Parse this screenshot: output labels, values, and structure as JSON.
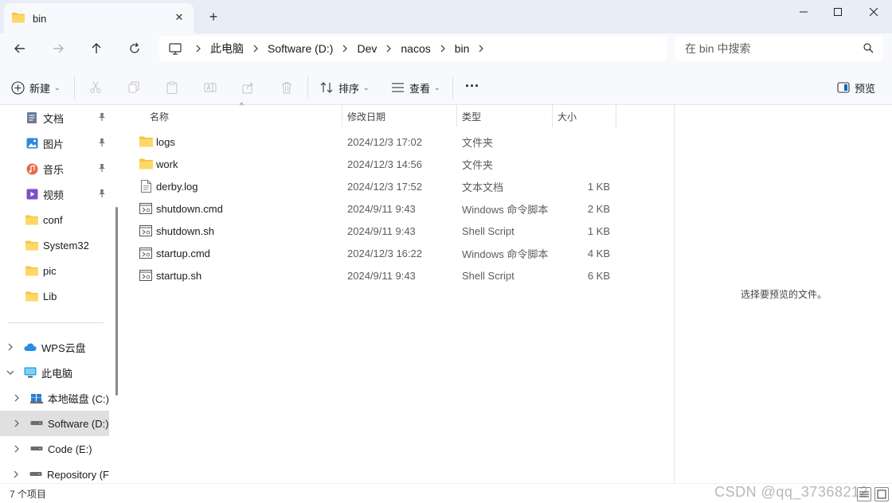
{
  "tab": {
    "title": "bin",
    "close_glyph": "✕",
    "new_tab_glyph": "+"
  },
  "breadcrumb": [
    "此电脑",
    "Software (D:)",
    "Dev",
    "nacos",
    "bin"
  ],
  "search": {
    "placeholder": "在 bin 中搜索"
  },
  "toolbar": {
    "new_label": "新建",
    "sort_label": "排序",
    "view_label": "查看",
    "more_glyph": "···",
    "preview_label": "预览"
  },
  "nav": {
    "quick": [
      {
        "label": "文档",
        "icon": "document-icon",
        "pinned": true
      },
      {
        "label": "图片",
        "icon": "pictures-icon",
        "pinned": true
      },
      {
        "label": "音乐",
        "icon": "music-icon",
        "pinned": true
      },
      {
        "label": "视频",
        "icon": "video-icon",
        "pinned": true
      },
      {
        "label": "conf",
        "icon": "folder-icon",
        "pinned": false
      },
      {
        "label": "System32",
        "icon": "folder-icon",
        "pinned": false
      },
      {
        "label": "pic",
        "icon": "folder-icon",
        "pinned": false
      },
      {
        "label": "Lib",
        "icon": "folder-icon",
        "pinned": false
      }
    ],
    "tree": [
      {
        "label": "WPS云盘",
        "icon": "cloud-icon",
        "expanded": false,
        "indent": 0
      },
      {
        "label": "此电脑",
        "icon": "computer-icon",
        "expanded": true,
        "indent": 0
      },
      {
        "label": "本地磁盘 (C:)",
        "icon": "windows-drive-icon",
        "expanded": false,
        "indent": 1
      },
      {
        "label": "Software (D:)",
        "icon": "drive-icon",
        "expanded": false,
        "indent": 1,
        "selected": true
      },
      {
        "label": "Code (E:)",
        "icon": "drive-icon",
        "expanded": false,
        "indent": 1
      },
      {
        "label": "Repository (F",
        "icon": "drive-icon",
        "expanded": false,
        "indent": 1
      }
    ]
  },
  "columns": {
    "name": "名称",
    "date": "修改日期",
    "type": "类型",
    "size": "大小"
  },
  "files": [
    {
      "name": "logs",
      "date": "2024/12/3 17:02",
      "type": "文件夹",
      "size": "",
      "icon": "folder-icon"
    },
    {
      "name": "work",
      "date": "2024/12/3 14:56",
      "type": "文件夹",
      "size": "",
      "icon": "folder-icon"
    },
    {
      "name": "derby.log",
      "date": "2024/12/3 17:52",
      "type": "文本文档",
      "size": "1 KB",
      "icon": "text-file-icon"
    },
    {
      "name": "shutdown.cmd",
      "date": "2024/9/11 9:43",
      "type": "Windows 命令脚本",
      "size": "2 KB",
      "icon": "script-file-icon"
    },
    {
      "name": "shutdown.sh",
      "date": "2024/9/11 9:43",
      "type": "Shell Script",
      "size": "1 KB",
      "icon": "script-file-icon"
    },
    {
      "name": "startup.cmd",
      "date": "2024/12/3 16:22",
      "type": "Windows 命令脚本",
      "size": "4 KB",
      "icon": "script-file-icon"
    },
    {
      "name": "startup.sh",
      "date": "2024/9/11 9:43",
      "type": "Shell Script",
      "size": "6 KB",
      "icon": "script-file-icon"
    }
  ],
  "preview": {
    "message": "选择要预览的文件。"
  },
  "status": {
    "item_count": "7 个项目"
  },
  "watermark": "CSDN @qq_37368212",
  "colors": {
    "folder": "#f6c445",
    "accent": "#0067c0",
    "selected": "#e0e0e0"
  }
}
